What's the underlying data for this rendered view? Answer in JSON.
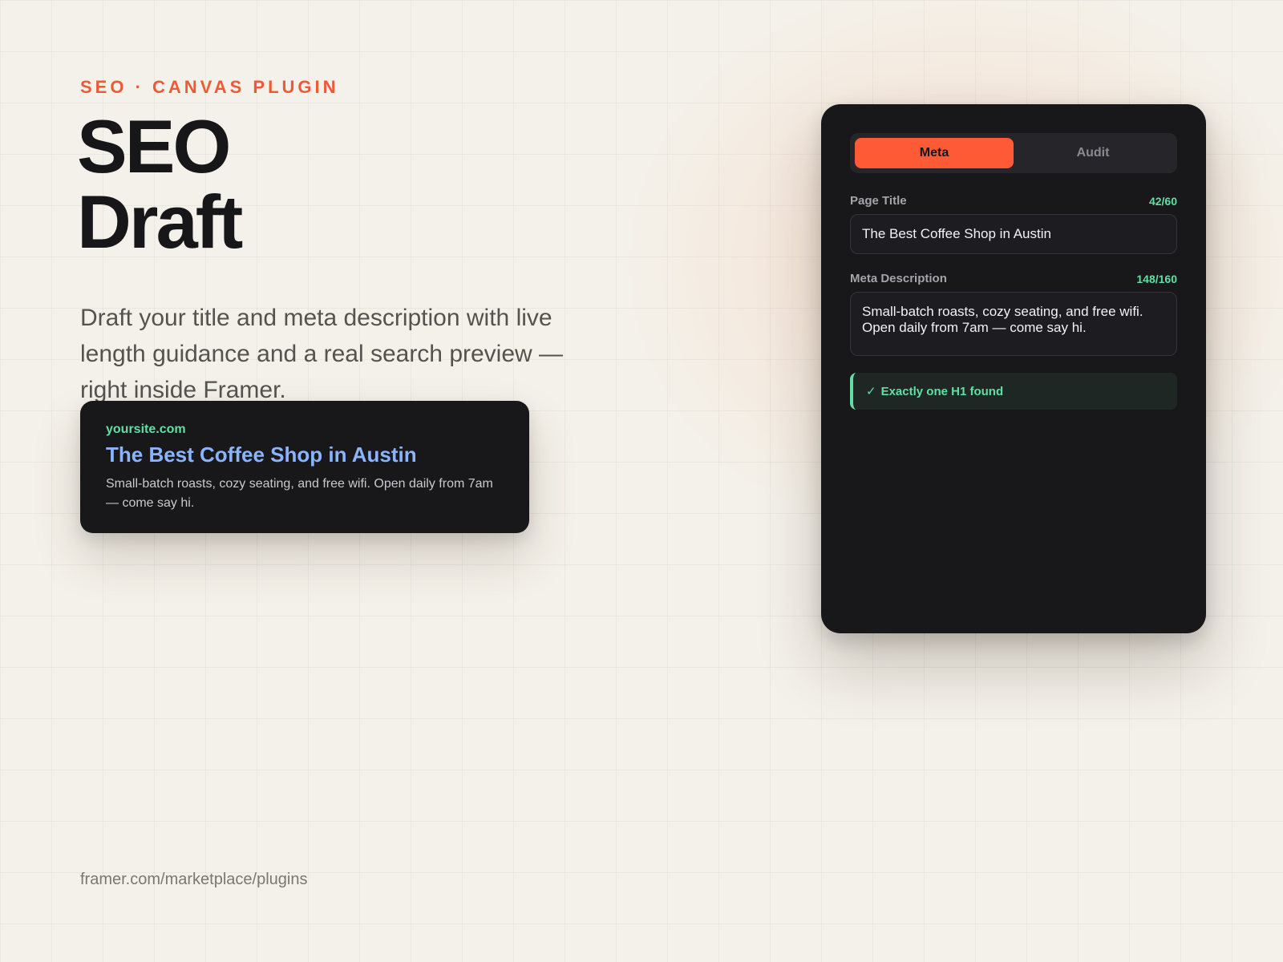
{
  "hero": {
    "eyebrow": "SEO · CANVAS PLUGIN",
    "title_line1": "SEO",
    "title_line2": "Draft",
    "description": "Draft your title and meta description with live length guidance and a real search preview — right inside Framer."
  },
  "preview": {
    "domain": "yoursite.com",
    "title": "The Best Coffee Shop in Austin",
    "description": "Small-batch roasts, cozy seating, and free wifi. Open daily from 7am — come say hi."
  },
  "panel": {
    "tabs": [
      {
        "label": "Meta",
        "active": true
      },
      {
        "label": "Audit",
        "active": false
      }
    ],
    "page_title": {
      "label": "Page Title",
      "count": "42/60",
      "value": "The Best Coffee Shop in Austin"
    },
    "meta_description": {
      "label": "Meta Description",
      "count": "148/160",
      "value": "Small-batch roasts, cozy seating, and free wifi. Open daily from 7am — come say hi."
    },
    "audit": {
      "icon": "check-icon",
      "icon_glyph": "✓",
      "message": "Exactly one H1 found"
    }
  },
  "footer": {
    "link": "framer.com/marketplace/plugins"
  },
  "colors": {
    "accent": "#ff5a36",
    "success": "#5fe0a2",
    "link_blue": "#8ab4ff",
    "panel_bg": "#18181b",
    "page_bg": "#f4f1ea"
  }
}
